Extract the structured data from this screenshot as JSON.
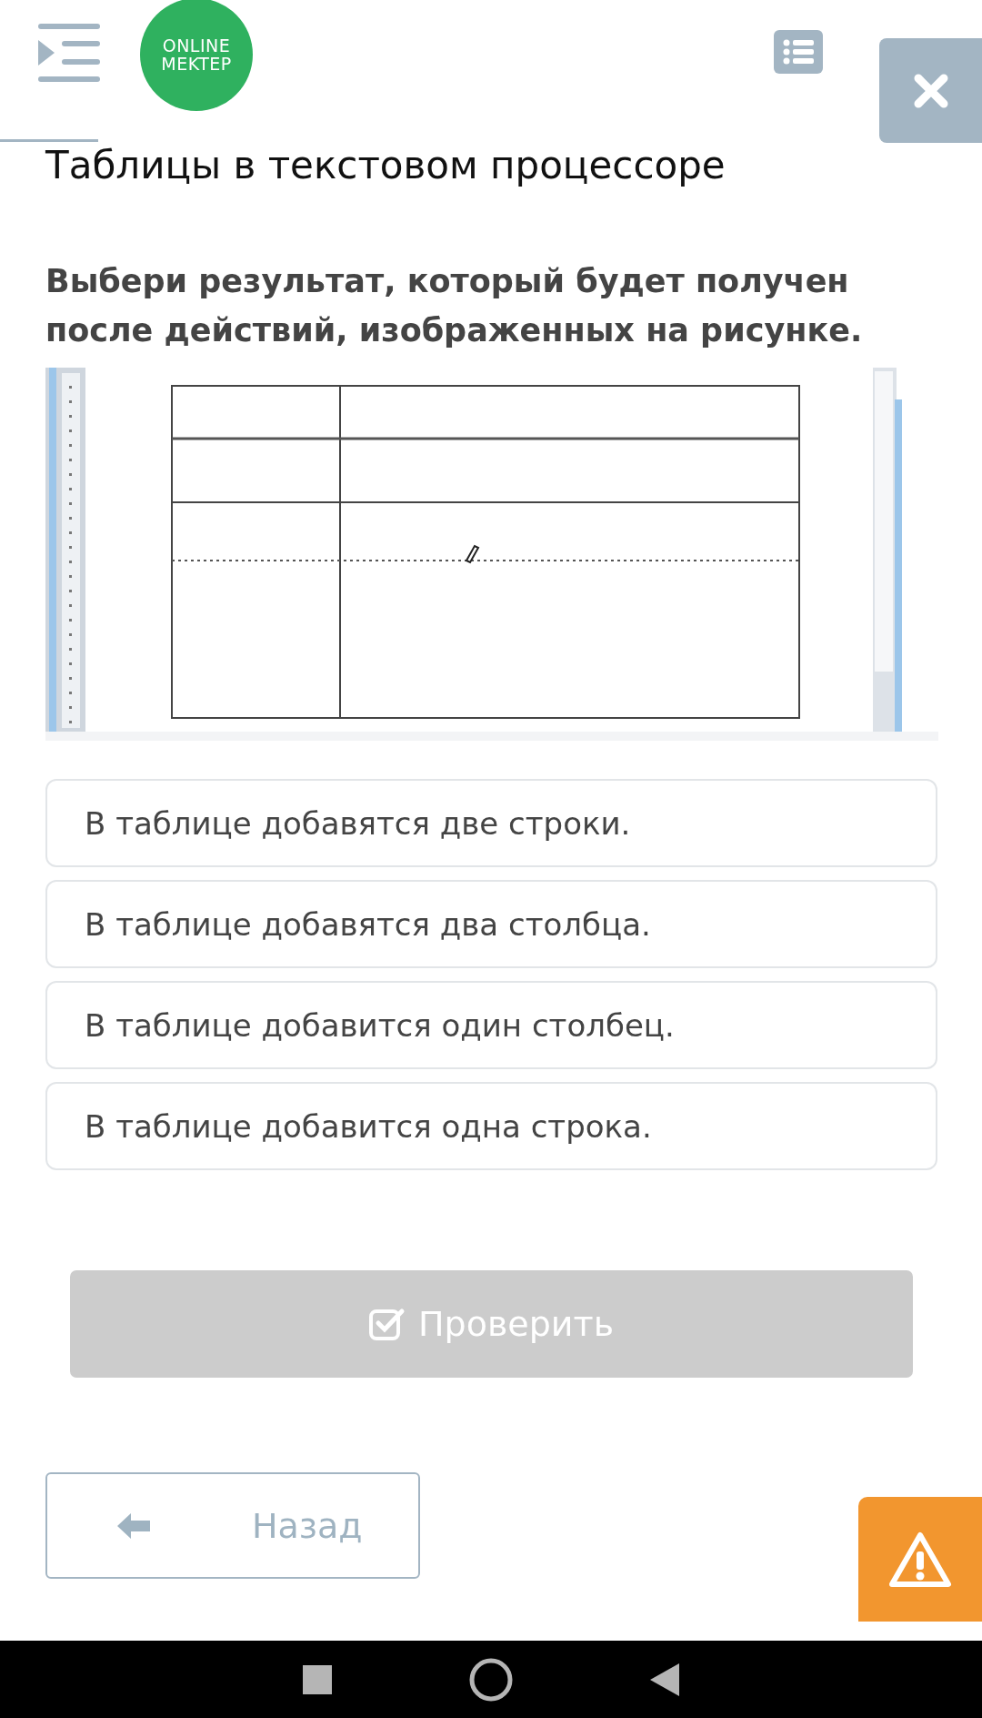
{
  "header": {
    "logo": [
      "ONLINE",
      "MEKTEP"
    ]
  },
  "title": "Таблицы в текстовом процессоре",
  "question": "Выбери результат, который будет получен после действий, изображенных на рисунке.",
  "options": [
    {
      "label": "В таблице добавятся две строки.",
      "selected": false
    },
    {
      "label": "В таблице добавятся два столбца.",
      "selected": false
    },
    {
      "label": "В таблице добавится один столбец.",
      "selected": false
    },
    {
      "label": "В таблице добавится одна строка.",
      "selected": false
    }
  ],
  "check_button": {
    "label": "Проверить",
    "disabled": true
  },
  "back_button": {
    "label": "Назад"
  }
}
